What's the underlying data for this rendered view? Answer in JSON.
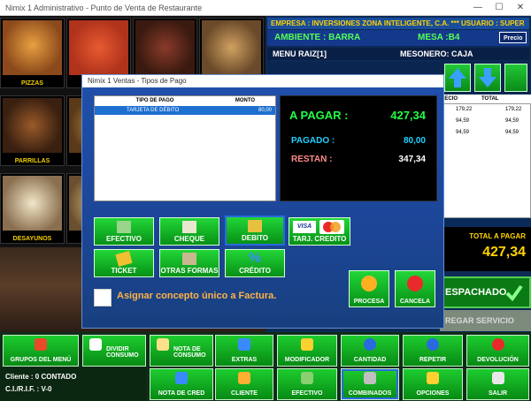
{
  "window": {
    "title": "Nimix 1 Administrativo - Punto de Venta de Restaurante",
    "min": "—",
    "max": "☐",
    "close": "✕"
  },
  "categories": [
    {
      "label": "PIZZAS",
      "color": "#8c4a1c"
    },
    {
      "label": "",
      "color": "#b0331c"
    },
    {
      "label": "",
      "color": "#5a2a1a"
    },
    {
      "label": "",
      "color": "#a06a3a"
    },
    {
      "label": "PARRILLAS",
      "color": "#6a4020"
    },
    {
      "label": "",
      "color": "#9a7a3a"
    },
    {
      "label": "DESAYUNOS",
      "color": "#d8c8a0"
    },
    {
      "label": "",
      "color": "#c0a060"
    }
  ],
  "header": {
    "empresa": "EMPRESA : INVERSIONES ZONA INTELIGENTE, C.A. *** USUARIO : SUPER",
    "ambiente": "AMBIENTE : BARRA",
    "mesa": "MESA :B4",
    "precio_button": "Precio",
    "menu_raiz": "MENU RAIZ[1]",
    "mesonero": "MESONERO: CAJA"
  },
  "order_table": {
    "headers": [
      "RECIO",
      "TOTAL"
    ],
    "rows": [
      [
        "179,22",
        "179,22"
      ],
      [
        "94,59",
        "94,59"
      ],
      [
        "94,59",
        "94,59"
      ]
    ]
  },
  "totals": {
    "label": "TOTAL A PAGAR",
    "value": "427,34"
  },
  "right_buttons": {
    "despachado": "ESPACHADO",
    "entregar": "REGAR SERVICIO"
  },
  "toolbar": [
    {
      "label": "GRUPOS DEL MENÚ",
      "icon": "basket-icon"
    },
    {
      "label": "DIVIDIR CONSUMO",
      "icon": "document-icon"
    },
    {
      "label": "NOTA DE CONSUMO",
      "icon": "note-icon"
    },
    {
      "label": "EXTRAS",
      "icon": "plus-icon"
    },
    {
      "label": "MODIFICADOR",
      "icon": "pencil-icon"
    },
    {
      "label": "CANTIDAD",
      "icon": "x-icon"
    },
    {
      "label": "REPETIR",
      "icon": "repeat-icon"
    },
    {
      "label": "DEVOLUCIÓN",
      "icon": "minus-icon"
    },
    {
      "label": "NOTA DE CRED",
      "icon": "undo-icon"
    },
    {
      "label": "CLIENTE",
      "icon": "people-icon"
    },
    {
      "label": "EFECTIVO",
      "icon": "cash-icon"
    },
    {
      "label": "COMBINADOS",
      "icon": "combo-icon"
    },
    {
      "label": "OPCIONES",
      "icon": "options-icon"
    },
    {
      "label": "SALIR",
      "icon": "exit-icon"
    }
  ],
  "client": {
    "cliente": "Cliente : 0 CONTADO",
    "rif": "C.I./R.I.F. : V-0"
  },
  "dialog": {
    "title": "Nimix 1 Ventas - Tipos de Pago",
    "table_headers": [
      "TIPO DE PAGO",
      "MONTO"
    ],
    "rows": [
      {
        "tipo": "TARJETA DE DÉBITO",
        "monto": "80,00"
      }
    ],
    "a_pagar_label": "A PAGAR :",
    "a_pagar_value": "427,34",
    "pagado_label": "PAGADO :",
    "pagado_value": "80,00",
    "restan_label": "RESTAN :",
    "restan_value": "347,34",
    "payment_buttons": [
      {
        "label": "EFECTIVO",
        "icon": "cash-icon"
      },
      {
        "label": "CHEQUE",
        "icon": "check-icon"
      },
      {
        "label": "DEBITO",
        "icon": "card-icon"
      },
      {
        "label": "TARJ. CREDITO",
        "icon": "credit-card-icon"
      },
      {
        "label": "TICKET",
        "icon": "ticket-icon"
      },
      {
        "label": "OTRAS FORMAS",
        "icon": "other-icon"
      },
      {
        "label": "CRÉDITO",
        "icon": "percent-icon"
      }
    ],
    "visa": "VISA",
    "mastercard": "MasterCard",
    "asignar": "Asignar concepto único a Factura.",
    "procesa": "PROCESA",
    "cancela": "CANCELA"
  }
}
